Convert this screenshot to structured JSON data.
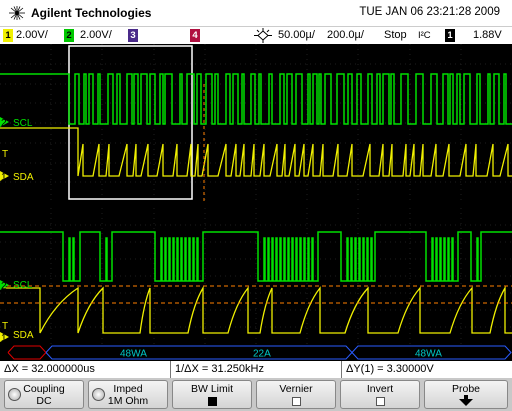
{
  "header": {
    "brand": "Agilent Technologies",
    "datetime": "TUE JAN 06 23:21:28 2009"
  },
  "settings": {
    "ch1_num": "1",
    "ch1_scale": "2.00V/",
    "ch2_num": "2",
    "ch2_scale": "2.00V/",
    "ch3_num": "3",
    "ch4_num": "4",
    "time_pos": "50.00µ/",
    "time_scale": "200.0µ/",
    "run_state": "Stop",
    "trigger_type": "I²C",
    "trigger_source": "1",
    "trigger_level": "1.88V",
    "colors": {
      "ch1": "#f0f000",
      "ch2": "#00e000",
      "ch3": "#7070ff",
      "ch4": "#ff3060"
    }
  },
  "waveform_labels": {
    "upper_scl": "SCL",
    "upper_sda": "SDA",
    "upper_scl_num": "2",
    "upper_sda_num": "1",
    "lower_scl": "SCL",
    "lower_sda": "SDA",
    "lower_scl_num": "2",
    "lower_sda_num": "1"
  },
  "decode": {
    "packets": [
      "48WA",
      "22A",
      "48WA"
    ]
  },
  "measurements": {
    "delta_x": "ΔX = 32.000000us",
    "inv_delta_x": "1/ΔX = 31.250kHz",
    "delta_y": "ΔY(1) = 3.30000V"
  },
  "softkeys": {
    "coupling_label": "Coupling",
    "coupling_value": "DC",
    "impedance_label": "Imped",
    "impedance_value": "1M Ohm",
    "bw_limit_label": "BW Limit",
    "bw_limit_on": true,
    "vernier_label": "Vernier",
    "vernier_on": false,
    "invert_label": "Invert",
    "invert_on": false,
    "probe_label": "Probe"
  }
}
